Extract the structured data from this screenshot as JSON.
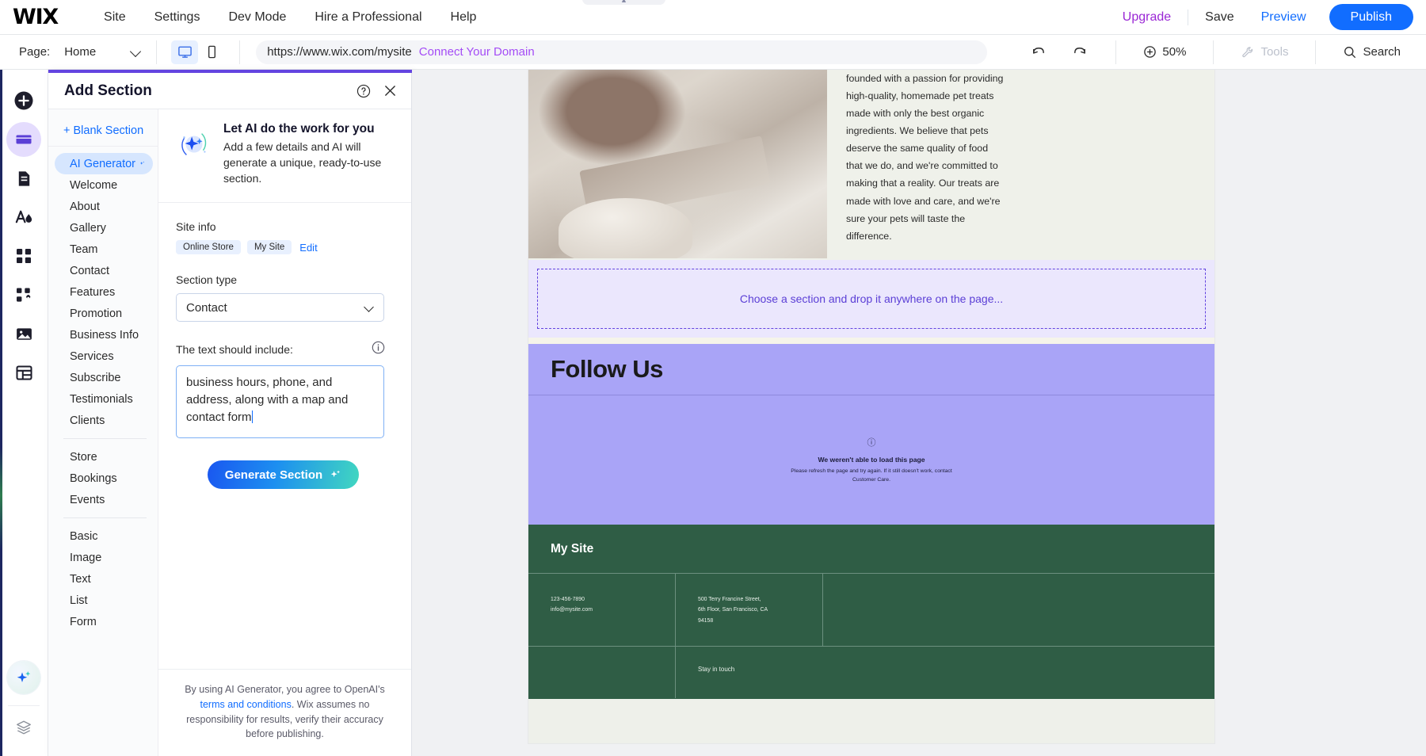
{
  "topbar": {
    "logo": "WIX",
    "menu": [
      "Site",
      "Settings",
      "Dev Mode",
      "Hire a Professional",
      "Help"
    ],
    "upgrade": "Upgrade",
    "save": "Save",
    "preview": "Preview",
    "publish": "Publish"
  },
  "secondbar": {
    "page_label": "Page:",
    "page_name": "Home",
    "url": "https://www.wix.com/mysite",
    "connect_domain": "Connect Your Domain",
    "zoom": "50%",
    "tools": "Tools",
    "search": "Search"
  },
  "rail": {
    "items": [
      {
        "name": "add-elements",
        "icon": "plus-circle-icon"
      },
      {
        "name": "add-section",
        "icon": "sections-icon",
        "active": true
      },
      {
        "name": "pages-menu",
        "icon": "page-icon"
      },
      {
        "name": "site-design",
        "icon": "design-icon"
      },
      {
        "name": "apps",
        "icon": "apps-grid-icon"
      },
      {
        "name": "app-market",
        "icon": "puzzle-gear-icon"
      },
      {
        "name": "media",
        "icon": "image-icon"
      },
      {
        "name": "cms",
        "icon": "table-icon"
      }
    ],
    "ai_button": "ai-sparkle-icon",
    "layers_button": "layers-icon"
  },
  "panel": {
    "title": "Add Section",
    "help_icon": "question-mark-icon",
    "close_icon": "close-icon",
    "blank_section": "+ Blank Section",
    "categories_primary": [
      "AI Generator",
      "Welcome",
      "About",
      "Gallery",
      "Team",
      "Contact",
      "Features",
      "Promotion",
      "Business Info",
      "Services",
      "Subscribe",
      "Testimonials",
      "Clients"
    ],
    "categories_apps": [
      "Store",
      "Bookings",
      "Events"
    ],
    "categories_basic": [
      "Basic",
      "Image",
      "Text",
      "List",
      "Form"
    ],
    "selected_category": "AI Generator",
    "promo": {
      "title": "Let AI do the work for you",
      "subtitle": "Add a few details and AI will generate a unique, ready-to-use section."
    },
    "site_info": {
      "label": "Site info",
      "chips": [
        "Online Store",
        "My Site"
      ],
      "edit": "Edit"
    },
    "section_type": {
      "label": "Section type",
      "value": "Contact"
    },
    "text_include": {
      "label": "The text should include:",
      "value": "business hours, phone, and address, along with a map and contact form",
      "info_icon": "info-icon"
    },
    "generate_button": "Generate Section",
    "footer": {
      "part1": "By using AI Generator, you agree to OpenAI's ",
      "link": "terms and conditions",
      "part2": ". Wix assumes no responsibility for results, verify their accuracy before publishing."
    }
  },
  "canvas": {
    "hero_text": "founded with a passion for providing high-quality, homemade pet treats made with only the best organic ingredients. We believe that pets deserve the same quality of food that we do, and we're committed to making that a reality. Our treats are made with love and care, and we're sure your pets will taste the difference.",
    "dropzone": "Choose a section and drop it anywhere on the page...",
    "follow_title": "Follow Us",
    "error": {
      "icon": "info-circle-icon",
      "title": "We weren't able to load this page",
      "body": "Please refresh the page and try again. If it still doesn't work, contact Customer Care."
    },
    "footer": {
      "site_name": "My Site",
      "phone": "123-456-7890",
      "email": "info@mysite.com",
      "address_line1": "500 Terry Francine Street,",
      "address_line2": "6th Floor, San Francisco, CA",
      "address_line3": "94158",
      "bottom_text": "Stay in touch"
    }
  },
  "colors": {
    "brand_blue": "#116dff",
    "upgrade_purple": "#9a27d5",
    "panel_accent": "#6344e0",
    "dropzone_purple": "#6344e0",
    "follow_band": "#a9a4f7",
    "site_footer_green": "#2f5d45"
  }
}
